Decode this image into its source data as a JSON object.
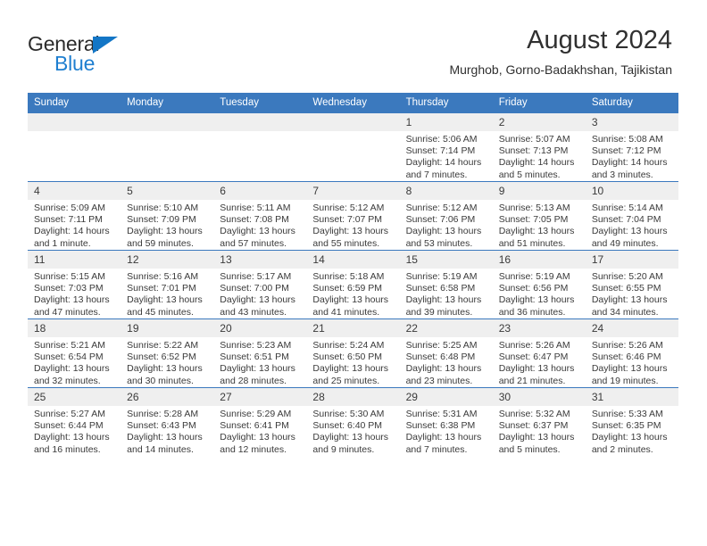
{
  "brand": {
    "name_primary": "General",
    "name_secondary": "Blue",
    "accent_color": "#1376c6"
  },
  "header": {
    "title": "August 2024",
    "subtitle": "Murghob, Gorno-Badakhshan, Tajikistan"
  },
  "theme": {
    "header_blue": "#3b79be",
    "daynum_gray": "#efefef",
    "text": "#3a3a3a"
  },
  "calendar": {
    "weekdays": [
      "Sunday",
      "Monday",
      "Tuesday",
      "Wednesday",
      "Thursday",
      "Friday",
      "Saturday"
    ],
    "weeks": [
      [
        {
          "day": "",
          "lines": []
        },
        {
          "day": "",
          "lines": []
        },
        {
          "day": "",
          "lines": []
        },
        {
          "day": "",
          "lines": []
        },
        {
          "day": "1",
          "lines": [
            "Sunrise: 5:06 AM",
            "Sunset: 7:14 PM",
            "Daylight: 14 hours and 7 minutes."
          ]
        },
        {
          "day": "2",
          "lines": [
            "Sunrise: 5:07 AM",
            "Sunset: 7:13 PM",
            "Daylight: 14 hours and 5 minutes."
          ]
        },
        {
          "day": "3",
          "lines": [
            "Sunrise: 5:08 AM",
            "Sunset: 7:12 PM",
            "Daylight: 14 hours and 3 minutes."
          ]
        }
      ],
      [
        {
          "day": "4",
          "lines": [
            "Sunrise: 5:09 AM",
            "Sunset: 7:11 PM",
            "Daylight: 14 hours and 1 minute."
          ]
        },
        {
          "day": "5",
          "lines": [
            "Sunrise: 5:10 AM",
            "Sunset: 7:09 PM",
            "Daylight: 13 hours and 59 minutes."
          ]
        },
        {
          "day": "6",
          "lines": [
            "Sunrise: 5:11 AM",
            "Sunset: 7:08 PM",
            "Daylight: 13 hours and 57 minutes."
          ]
        },
        {
          "day": "7",
          "lines": [
            "Sunrise: 5:12 AM",
            "Sunset: 7:07 PM",
            "Daylight: 13 hours and 55 minutes."
          ]
        },
        {
          "day": "8",
          "lines": [
            "Sunrise: 5:12 AM",
            "Sunset: 7:06 PM",
            "Daylight: 13 hours and 53 minutes."
          ]
        },
        {
          "day": "9",
          "lines": [
            "Sunrise: 5:13 AM",
            "Sunset: 7:05 PM",
            "Daylight: 13 hours and 51 minutes."
          ]
        },
        {
          "day": "10",
          "lines": [
            "Sunrise: 5:14 AM",
            "Sunset: 7:04 PM",
            "Daylight: 13 hours and 49 minutes."
          ]
        }
      ],
      [
        {
          "day": "11",
          "lines": [
            "Sunrise: 5:15 AM",
            "Sunset: 7:03 PM",
            "Daylight: 13 hours and 47 minutes."
          ]
        },
        {
          "day": "12",
          "lines": [
            "Sunrise: 5:16 AM",
            "Sunset: 7:01 PM",
            "Daylight: 13 hours and 45 minutes."
          ]
        },
        {
          "day": "13",
          "lines": [
            "Sunrise: 5:17 AM",
            "Sunset: 7:00 PM",
            "Daylight: 13 hours and 43 minutes."
          ]
        },
        {
          "day": "14",
          "lines": [
            "Sunrise: 5:18 AM",
            "Sunset: 6:59 PM",
            "Daylight: 13 hours and 41 minutes."
          ]
        },
        {
          "day": "15",
          "lines": [
            "Sunrise: 5:19 AM",
            "Sunset: 6:58 PM",
            "Daylight: 13 hours and 39 minutes."
          ]
        },
        {
          "day": "16",
          "lines": [
            "Sunrise: 5:19 AM",
            "Sunset: 6:56 PM",
            "Daylight: 13 hours and 36 minutes."
          ]
        },
        {
          "day": "17",
          "lines": [
            "Sunrise: 5:20 AM",
            "Sunset: 6:55 PM",
            "Daylight: 13 hours and 34 minutes."
          ]
        }
      ],
      [
        {
          "day": "18",
          "lines": [
            "Sunrise: 5:21 AM",
            "Sunset: 6:54 PM",
            "Daylight: 13 hours and 32 minutes."
          ]
        },
        {
          "day": "19",
          "lines": [
            "Sunrise: 5:22 AM",
            "Sunset: 6:52 PM",
            "Daylight: 13 hours and 30 minutes."
          ]
        },
        {
          "day": "20",
          "lines": [
            "Sunrise: 5:23 AM",
            "Sunset: 6:51 PM",
            "Daylight: 13 hours and 28 minutes."
          ]
        },
        {
          "day": "21",
          "lines": [
            "Sunrise: 5:24 AM",
            "Sunset: 6:50 PM",
            "Daylight: 13 hours and 25 minutes."
          ]
        },
        {
          "day": "22",
          "lines": [
            "Sunrise: 5:25 AM",
            "Sunset: 6:48 PM",
            "Daylight: 13 hours and 23 minutes."
          ]
        },
        {
          "day": "23",
          "lines": [
            "Sunrise: 5:26 AM",
            "Sunset: 6:47 PM",
            "Daylight: 13 hours and 21 minutes."
          ]
        },
        {
          "day": "24",
          "lines": [
            "Sunrise: 5:26 AM",
            "Sunset: 6:46 PM",
            "Daylight: 13 hours and 19 minutes."
          ]
        }
      ],
      [
        {
          "day": "25",
          "lines": [
            "Sunrise: 5:27 AM",
            "Sunset: 6:44 PM",
            "Daylight: 13 hours and 16 minutes."
          ]
        },
        {
          "day": "26",
          "lines": [
            "Sunrise: 5:28 AM",
            "Sunset: 6:43 PM",
            "Daylight: 13 hours and 14 minutes."
          ]
        },
        {
          "day": "27",
          "lines": [
            "Sunrise: 5:29 AM",
            "Sunset: 6:41 PM",
            "Daylight: 13 hours and 12 minutes."
          ]
        },
        {
          "day": "28",
          "lines": [
            "Sunrise: 5:30 AM",
            "Sunset: 6:40 PM",
            "Daylight: 13 hours and 9 minutes."
          ]
        },
        {
          "day": "29",
          "lines": [
            "Sunrise: 5:31 AM",
            "Sunset: 6:38 PM",
            "Daylight: 13 hours and 7 minutes."
          ]
        },
        {
          "day": "30",
          "lines": [
            "Sunrise: 5:32 AM",
            "Sunset: 6:37 PM",
            "Daylight: 13 hours and 5 minutes."
          ]
        },
        {
          "day": "31",
          "lines": [
            "Sunrise: 5:33 AM",
            "Sunset: 6:35 PM",
            "Daylight: 13 hours and 2 minutes."
          ]
        }
      ]
    ]
  }
}
